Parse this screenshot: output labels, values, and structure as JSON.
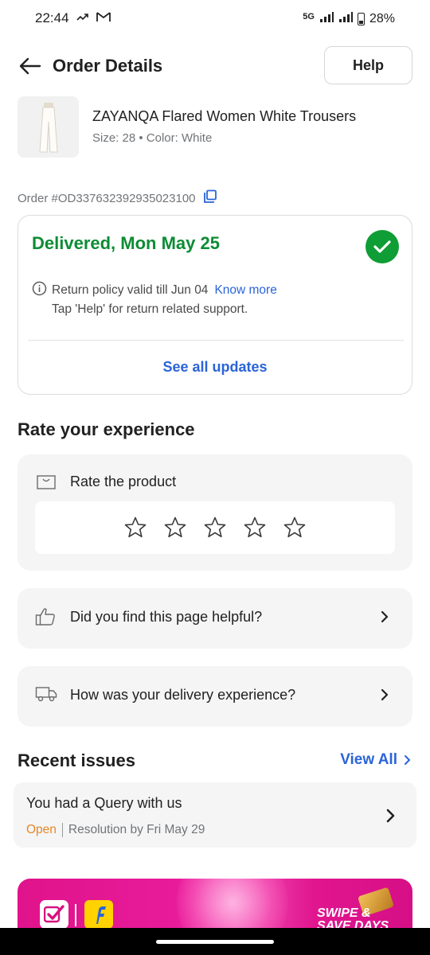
{
  "status_bar": {
    "time": "22:44",
    "network": "5G",
    "battery": "28%"
  },
  "header": {
    "title": "Order Details",
    "help_label": "Help"
  },
  "product": {
    "name": "ZAYANQA Flared Women White Trousers",
    "meta": "Size: 28 • Color: White"
  },
  "order": {
    "id_text": "Order #OD337632392935023100"
  },
  "status_card": {
    "title": "Delivered, Mon May 25",
    "return_policy": "Return policy valid till Jun 04",
    "know_more": "Know more",
    "return_help": "Tap 'Help' for return related support.",
    "see_all": "See all updates",
    "accent_color": "#0d8c34"
  },
  "rating": {
    "section_title": "Rate your experience",
    "rate_product_label": "Rate the product",
    "stars": 5,
    "selected": 0
  },
  "feedback": {
    "helpful_label": "Did you find this page helpful?",
    "delivery_label": "How was your delivery experience?"
  },
  "recent_issues": {
    "title": "Recent issues",
    "view_all": "View All",
    "items": [
      {
        "title": "You had a Query with us",
        "status": "Open",
        "resolution": "Resolution by Fri May 29"
      }
    ]
  },
  "banner": {
    "text": "SWIPE & SAVE DAYS"
  },
  "colors": {
    "link_blue": "#2a64d8",
    "delivered_green": "#0d8c34",
    "open_orange": "#e4882a"
  }
}
